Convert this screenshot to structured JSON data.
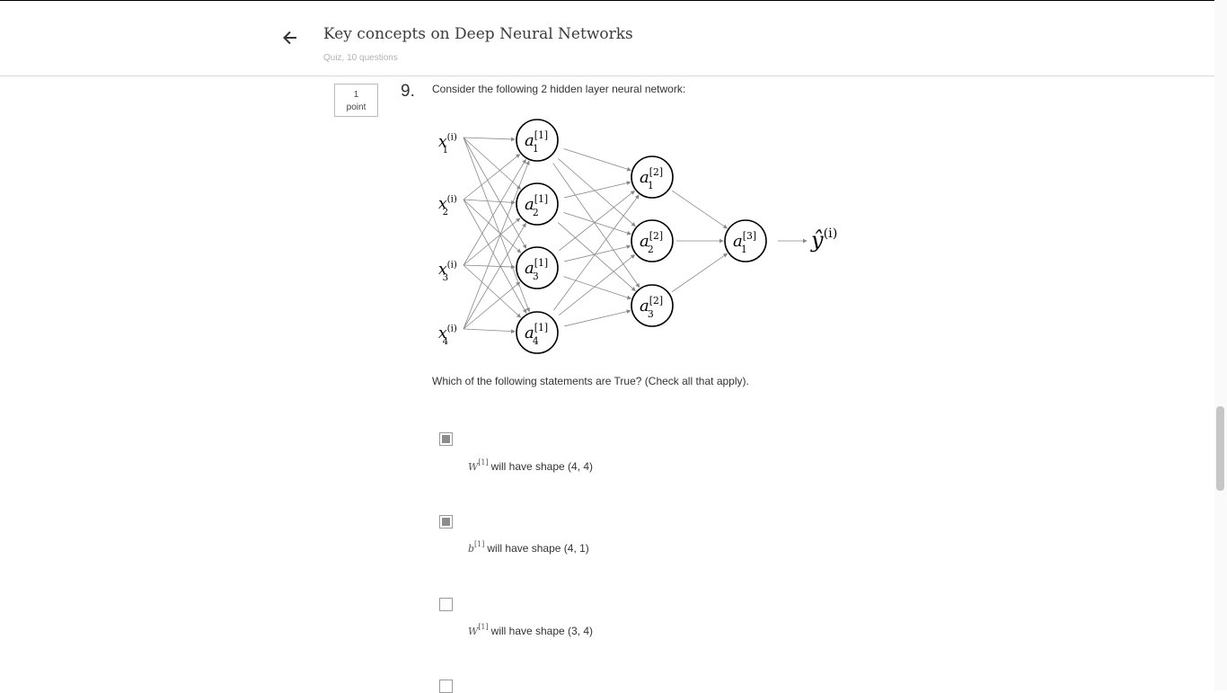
{
  "header": {
    "title": "Key concepts on Deep Neural Networks",
    "subtitle": "Quiz, 10 questions"
  },
  "question": {
    "points_value": "1",
    "points_label": "point",
    "number": "9.",
    "text": "Consider the following 2 hidden layer neural network:",
    "prompt": "Which of the following statements are True? (Check all that apply)."
  },
  "diagram": {
    "inputs": [
      {
        "base": "x",
        "sub": "1",
        "sup": "(i)"
      },
      {
        "base": "x",
        "sub": "2",
        "sup": "(i)"
      },
      {
        "base": "x",
        "sub": "3",
        "sup": "(i)"
      },
      {
        "base": "x",
        "sub": "4",
        "sup": "(i)"
      }
    ],
    "layer1": [
      {
        "base": "a",
        "sub": "1",
        "sup": "[1]"
      },
      {
        "base": "a",
        "sub": "2",
        "sup": "[1]"
      },
      {
        "base": "a",
        "sub": "3",
        "sup": "[1]"
      },
      {
        "base": "a",
        "sub": "4",
        "sup": "[1]"
      }
    ],
    "layer2": [
      {
        "base": "a",
        "sub": "1",
        "sup": "[2]"
      },
      {
        "base": "a",
        "sub": "2",
        "sup": "[2]"
      },
      {
        "base": "a",
        "sub": "3",
        "sup": "[2]"
      }
    ],
    "layer3": [
      {
        "base": "a",
        "sub": "1",
        "sup": "[3]"
      }
    ],
    "output": {
      "base": "ŷ",
      "sup": "(i)"
    }
  },
  "options": [
    {
      "var": "W",
      "sup": "[1]",
      "text": "will have shape (4, 4)",
      "checked": true
    },
    {
      "var": "b",
      "sup": "[1]",
      "text": "will have shape (4, 1)",
      "checked": true
    },
    {
      "var": "W",
      "sup": "[1]",
      "text": "will have shape (3, 4)",
      "checked": false
    },
    {
      "var": "",
      "sup": "",
      "text": "",
      "checked": false
    }
  ],
  "colors": {
    "text": "#333333",
    "subtitle": "#b3b3b3",
    "checkbox_fill": "#8c8c8c",
    "edge": "#888888"
  },
  "icons": {
    "back": "arrow-left-icon"
  }
}
